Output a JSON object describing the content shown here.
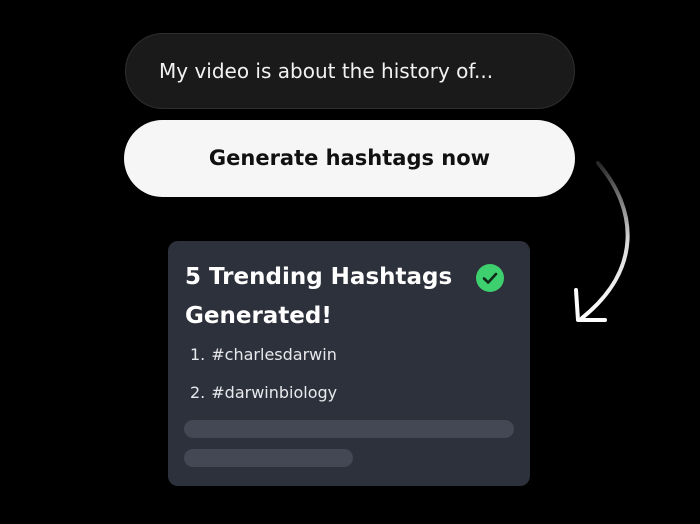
{
  "prompt": {
    "text": "My video is about the history of..."
  },
  "generate_button": {
    "label": "Generate hashtags now"
  },
  "result_card": {
    "title": "5 Trending Hashtags Generated!",
    "status_icon": "check-circle-icon",
    "hashtags": [
      {
        "number": "1.",
        "tag": "#charlesdarwin"
      },
      {
        "number": "2.",
        "tag": "#darwinbiology"
      }
    ]
  },
  "colors": {
    "background": "#000000",
    "input_bg": "#1a1a1a",
    "button_bg": "#f6f6f6",
    "card_bg": "#2d313b",
    "placeholder_bar": "#444854",
    "success_green": "#3ecf6e"
  }
}
